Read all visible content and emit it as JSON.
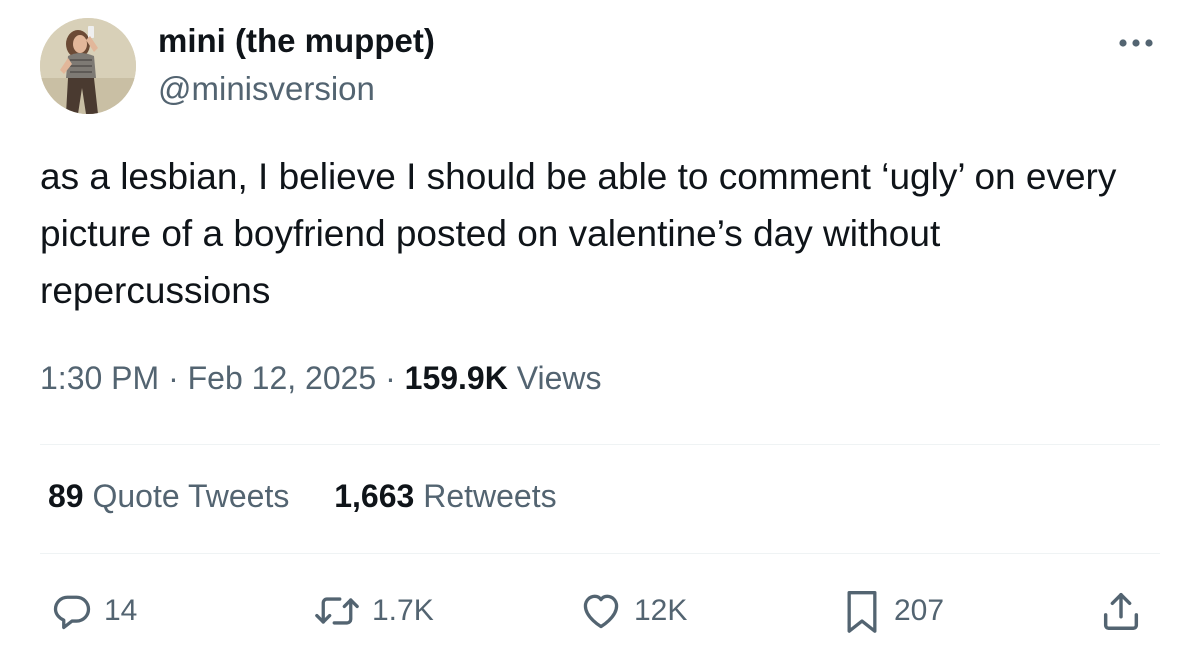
{
  "author": {
    "display_name": "mini (the muppet)",
    "handle": "@minisversion"
  },
  "tweet": {
    "text": "as a lesbian, I believe I should be able to comment ‘ugly’ on every picture of a boyfriend posted on valentine’s day without repercussions",
    "time": "1:30 PM",
    "separator": "·",
    "date": "Feb 12, 2025",
    "views_count": "159.9K",
    "views_label": "Views"
  },
  "stats": {
    "quote_count": "89",
    "quote_label": "Quote Tweets",
    "retweet_count": "1,663",
    "retweet_label": "Retweets"
  },
  "actions": {
    "replies": "14",
    "retweets": "1.7K",
    "likes": "12K",
    "bookmarks": "207"
  },
  "icons": {
    "more": "more-horizontal-icon",
    "reply": "reply-icon",
    "retweet": "retweet-icon",
    "like": "heart-icon",
    "bookmark": "bookmark-icon",
    "share": "share-icon"
  },
  "colors": {
    "text_primary": "#0f1419",
    "text_secondary": "#536471",
    "divider": "#eff3f4"
  }
}
